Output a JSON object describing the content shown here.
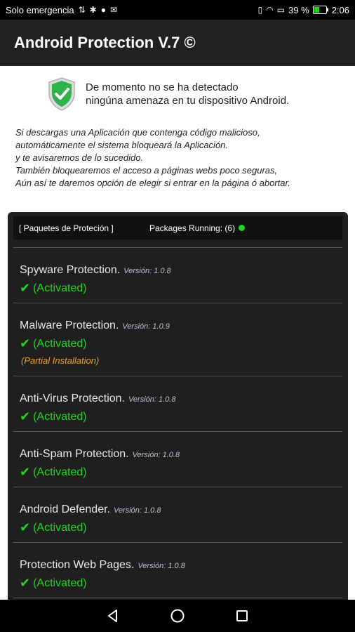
{
  "status_bar": {
    "carrier": "Solo emergencia",
    "battery": "39 %",
    "time": "2:06"
  },
  "app_bar": {
    "title": "Android Protection V.7 ©"
  },
  "notice": {
    "line1": "De momento no se ha detectado",
    "line2": "ningúna amenaza en tu dispositivo Android."
  },
  "info_lines": [
    "Si descargas una Aplicación que contenga código malicioso,",
    "automáticamente el sistema bloqueará la Aplicación.",
    "y te avisaremos de lo sucedido.",
    "También bloquearemos el acceso a páginas webs poco seguras,",
    "Aún así te daremos opción de elegir si entrar en la página ó abortar."
  ],
  "panel": {
    "packages_label": "[ Paquetes de Proteción ]",
    "running_label": "Packages Running: (6)",
    "items": [
      {
        "title": "Spyware Protection.",
        "version": "Versión: 1.0.8",
        "status": "(Activated)"
      },
      {
        "title": "Malware Protection.",
        "version": "Versión: 1.0.9",
        "status": "(Activated)",
        "note": "(Partial Installation)"
      },
      {
        "title": "Anti-Virus Protection.",
        "version": "Versión: 1.0.8",
        "status": "(Activated)"
      },
      {
        "title": "Anti-Spam Protection.",
        "version": "Versión: 1.0.8",
        "status": "(Activated)"
      },
      {
        "title": "Android Defender.",
        "version": "Versión: 1.0.8",
        "status": "(Activated)"
      },
      {
        "title": "Protection Web Pages.",
        "version": "Versión: 1.0.8",
        "status": "(Activated)"
      }
    ]
  },
  "colors": {
    "accent_green": "#21d521",
    "warning_orange": "#f0a020",
    "appbar": "#212121"
  }
}
